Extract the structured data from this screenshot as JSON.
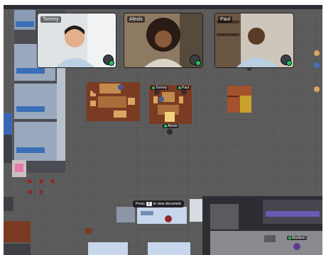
{
  "video_tiles": [
    {
      "name": "Tommy"
    },
    {
      "name": "Alexis"
    },
    {
      "name": "Paul"
    }
  ],
  "player_tags": {
    "tommy": "Tommy",
    "paul": "Paul",
    "alexis": "Alexis",
    "madison": "Madison"
  },
  "prompt": {
    "prefix": "Press",
    "key": "X",
    "suffix": "to view document"
  },
  "colors": {
    "floor": "#5c5c5c",
    "wall": "#2d2e33",
    "carpet": "#7a3b22",
    "online": "#22c55e"
  }
}
